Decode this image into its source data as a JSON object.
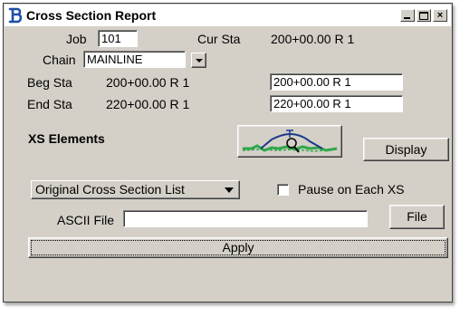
{
  "window": {
    "title": "Cross Section Report",
    "icon": "bentley-b-icon",
    "controls": {
      "minimize": "minimize-icon",
      "maximize": "maximize-icon",
      "close": "close-icon",
      "close_glyph": "×"
    }
  },
  "job": {
    "label": "Job",
    "value": "101"
  },
  "cur_sta": {
    "label": "Cur Sta",
    "value": "200+00.00 R 1"
  },
  "chain": {
    "label": "Chain",
    "value": "MAINLINE"
  },
  "beg_sta": {
    "label": "Beg Sta",
    "value": "200+00.00 R 1",
    "field_value": "200+00.00 R 1"
  },
  "end_sta": {
    "label": "End Sta",
    "value": "220+00.00 R 1",
    "field_value": "220+00.00 R 1"
  },
  "xs_elements": {
    "label": "XS Elements",
    "icon": "cross-section-icon"
  },
  "display_button": {
    "label": "Display"
  },
  "list_select": {
    "value": "Original Cross Section List"
  },
  "pause_checkbox": {
    "label": "Pause on Each XS",
    "checked": false
  },
  "ascii_file": {
    "label": "ASCII File",
    "value": ""
  },
  "file_button": {
    "label": "File"
  },
  "apply_button": {
    "label": "Apply"
  },
  "colors": {
    "terrain_green": "#2fa84a",
    "profile_blue": "#1c3a8a",
    "title_icon_blue": "#1f4fa6"
  }
}
